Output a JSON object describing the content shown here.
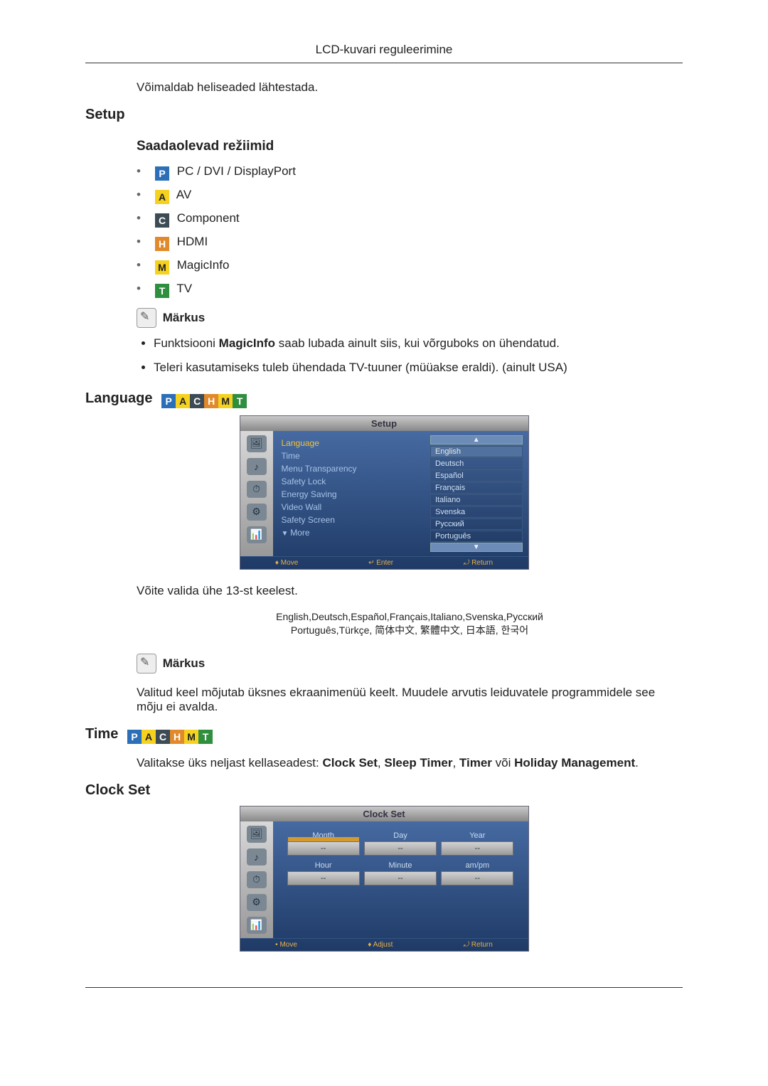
{
  "header": {
    "title": "LCD-kuvari reguleerimine"
  },
  "sound_reset": "Võimaldab heliseaded lähtestada.",
  "setup": {
    "heading": "Setup",
    "modes_heading": "Saadaolevad režiimid",
    "modes": {
      "pc": "PC / DVI / DisplayPort",
      "av": "AV",
      "component": "Component",
      "hdmi": "HDMI",
      "magic": "MagicInfo",
      "tv": "TV"
    },
    "note_label": "Märkus",
    "note1_a": "Funktsiooni ",
    "note1_b": "MagicInfo",
    "note1_c": " saab lubada ainult siis, kui võrguboks on ühendatud.",
    "note2": "Teleri kasutamiseks tuleb ühendada TV-tuuner (müüakse eraldi). (ainult USA)"
  },
  "language": {
    "heading": "Language",
    "osd": {
      "title": "Setup",
      "menu": {
        "language": "Language",
        "time": "Time",
        "transparency": "Menu Transparency",
        "safety_lock": "Safety Lock",
        "energy": "Energy Saving",
        "videowall": "Video Wall",
        "safety_screen": "Safety Screen",
        "more": "More"
      },
      "options": {
        "english": "English",
        "deutsch": "Deutsch",
        "espanol": "Español",
        "francais": "Français",
        "italiano": "Italiano",
        "svenska": "Svenska",
        "russkiy": "Русский",
        "portugues": "Português"
      },
      "foot": {
        "move": "Move",
        "enter": "Enter",
        "return": "Return"
      }
    },
    "intro": "Võite valida ühe 13-st keelest.",
    "list1": "English,Deutsch,Español,Français,Italiano,Svenska,Русский",
    "list2": "Português,Türkçe, 简体中文,  繁體中文, 日本語, 한국어",
    "note_label": "Märkus",
    "note_text": "Valitud keel mõjutab üksnes ekraanimenüü keelt. Muudele arvutis leiduvatele programmidele see mõju ei avalda."
  },
  "time": {
    "heading": "Time",
    "intro_a": "Valitakse üks neljast kellaseadest: ",
    "b1": "Clock Set",
    "c1": ", ",
    "b2": "Sleep Timer",
    "c2": ", ",
    "b3": "Timer",
    "c3": " või ",
    "b4": "Holiday Management",
    "c4": "."
  },
  "clockset": {
    "heading": "Clock Set",
    "osd": {
      "title": "Clock Set",
      "labels": {
        "month": "Month",
        "day": "Day",
        "year": "Year",
        "hour": "Hour",
        "minute": "Minute",
        "ampm": "am/pm"
      },
      "dash": "--",
      "foot": {
        "move": "Move",
        "adjust": "Adjust",
        "return": "Return"
      }
    }
  }
}
